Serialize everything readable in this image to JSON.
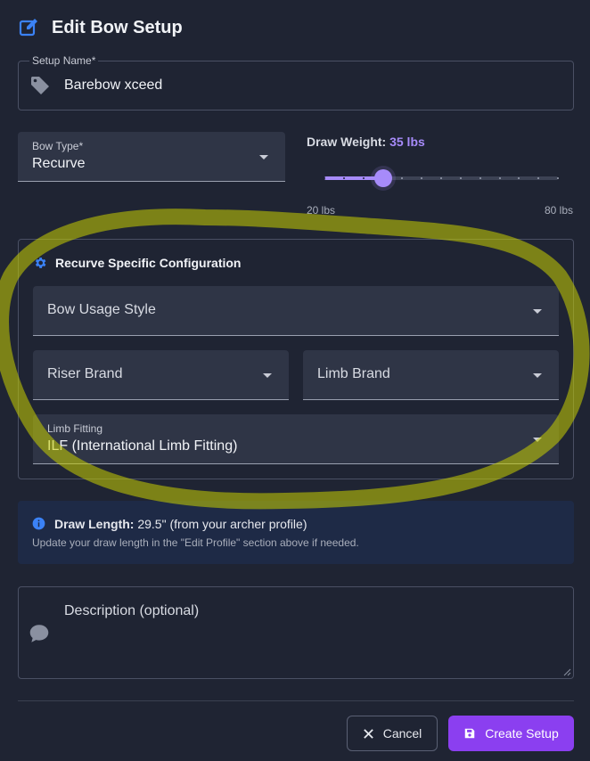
{
  "header": {
    "title": "Edit Bow Setup"
  },
  "setup_name": {
    "label": "Setup Name*",
    "value": "Barebow xceed"
  },
  "bow_type": {
    "label": "Bow Type*",
    "value": "Recurve"
  },
  "draw_weight": {
    "label": "Draw Weight:",
    "value_text": "35 lbs",
    "value": 35,
    "min": 20,
    "max": 80,
    "min_label": "20 lbs",
    "max_label": "80 lbs"
  },
  "config": {
    "title": "Recurve Specific Configuration",
    "usage_style": {
      "placeholder": "Bow Usage Style"
    },
    "riser_brand": {
      "placeholder": "Riser Brand"
    },
    "limb_brand": {
      "placeholder": "Limb Brand"
    },
    "limb_fitting": {
      "label": "Limb Fitting",
      "value": "ILF (International Limb Fitting)"
    }
  },
  "info": {
    "label": "Draw Length:",
    "value": "29.5\" (from your archer profile)",
    "hint": "Update your draw length in the \"Edit Profile\" section above if needed."
  },
  "description": {
    "placeholder": "Description (optional)"
  },
  "actions": {
    "cancel_label": "Cancel",
    "create_label": "Create Setup"
  },
  "colors": {
    "background": "#1f2433",
    "accent": "#a78bfa",
    "primary_button": "#8b3ff0",
    "icon_blue": "#3b82f6",
    "annotation": "#c8d000"
  }
}
